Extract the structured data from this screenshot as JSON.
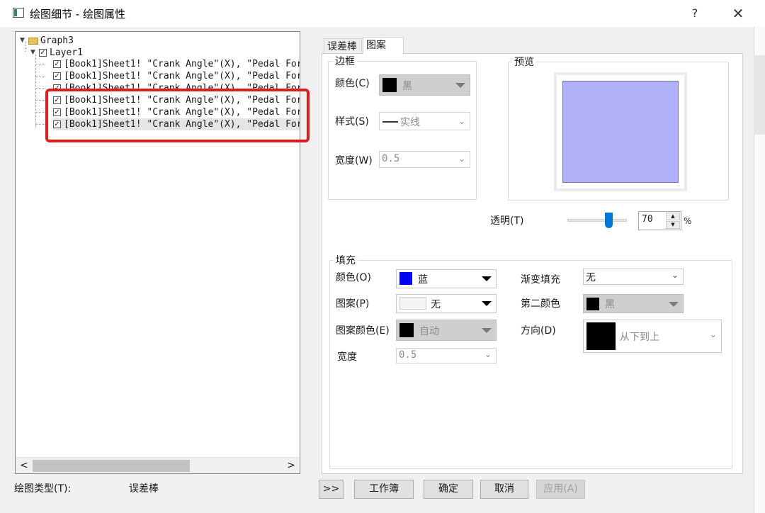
{
  "window": {
    "title": "绘图细节 - 绘图属性",
    "help": "?",
    "close": "✕"
  },
  "tree": {
    "root": "Graph3",
    "layer": "Layer1",
    "rows": [
      "[Book1]Sheet1! \"Crank Angle\"(X), \"Pedal For",
      "[Book1]Sheet1! \"Crank Angle\"(X), \"Pedal For",
      "[Book1]Sheet1! \"Crank Angle\"(X), \"Pedal For",
      "[Book1]Sheet1! \"Crank Angle\"(X), \"Pedal For",
      "[Book1]Sheet1! \"Crank Angle\"(X), \"Pedal For",
      "[Book1]Sheet1! \"Crank Angle\"(X), \"Pedal For"
    ],
    "scroll_left": "<",
    "scroll_right": ">"
  },
  "plot_type": {
    "label": "绘图类型(T):",
    "value": "误差棒"
  },
  "tabs": {
    "errorbar": "误差棒",
    "pattern": "图案"
  },
  "border": {
    "title": "边框",
    "color_label": "颜色(C)",
    "color_value": "黑",
    "style_label": "样式(S)",
    "style_value": "实线",
    "width_label": "宽度(W)",
    "width_value": "0.5"
  },
  "preview": {
    "title": "预览",
    "fill_color": "#b0b0f8"
  },
  "transparency": {
    "label": "透明(T)",
    "value": "70",
    "unit": "%",
    "fraction": 0.7
  },
  "fill": {
    "title": "填充",
    "color_label": "颜色(O)",
    "color_value": "蓝",
    "color_hex": "#0000ff",
    "pattern_label": "图案(P)",
    "pattern_value": "无",
    "pattern_color_label": "图案颜色(E)",
    "pattern_color_value": "自动",
    "width_label": "宽度",
    "width_value": "0.5",
    "gradient_label": "渐变填充",
    "gradient_value": "无",
    "second_color_label": "第二颜色",
    "second_color_value": "黑",
    "direction_label": "方向(D)",
    "direction_value": "从下到上"
  },
  "buttons": {
    "expand": ">>",
    "workbook": "工作簿",
    "ok": "确定",
    "cancel": "取消",
    "apply": "应用(A)"
  }
}
